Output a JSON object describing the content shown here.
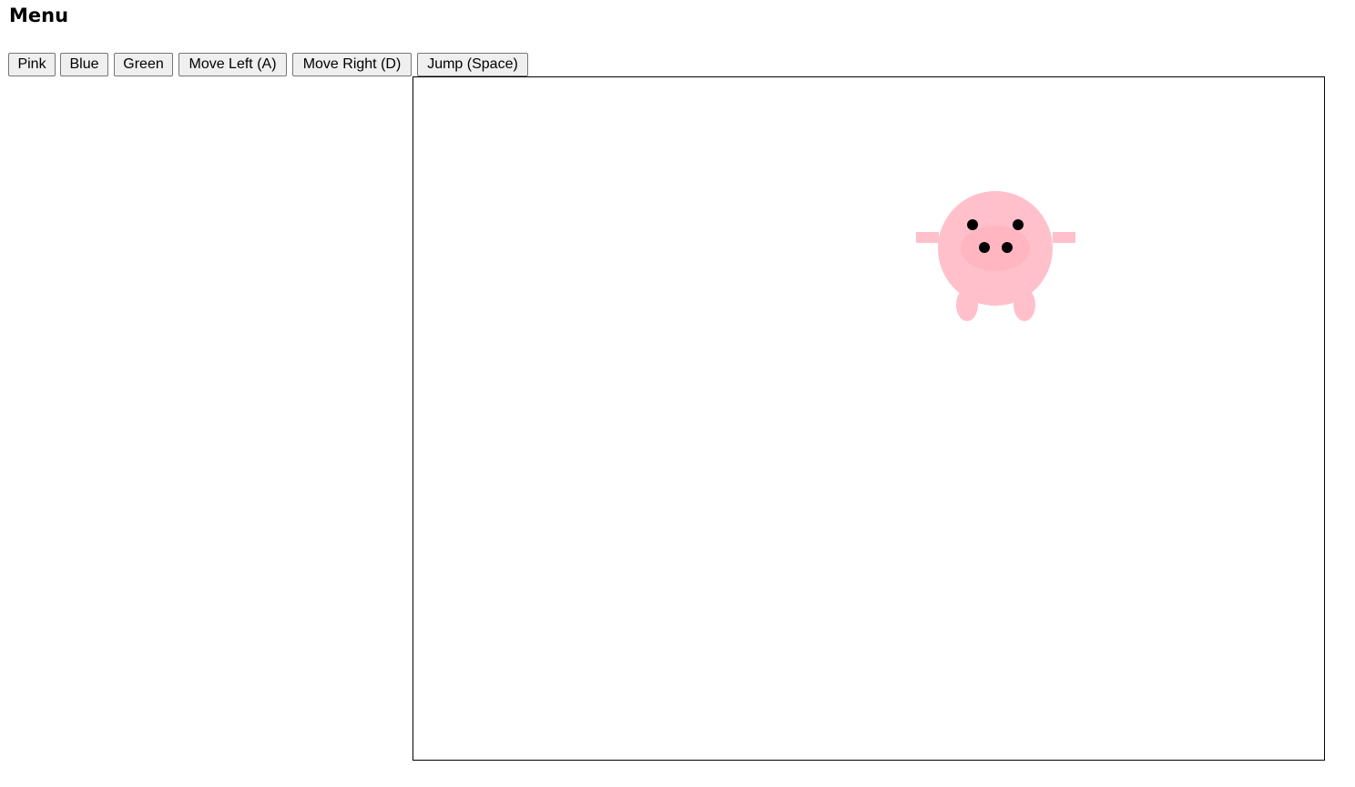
{
  "menu": {
    "title": "Menu"
  },
  "controls": {
    "pink_label": "Pink",
    "blue_label": "Blue",
    "green_label": "Green",
    "move_left_label": "Move Left (A)",
    "move_right_label": "Move Right (D)",
    "jump_label": "Jump (Space)"
  },
  "pig": {
    "body_color": "#ffc0cb",
    "snout_color": "#ffb6c1",
    "feature_color": "#000000"
  }
}
